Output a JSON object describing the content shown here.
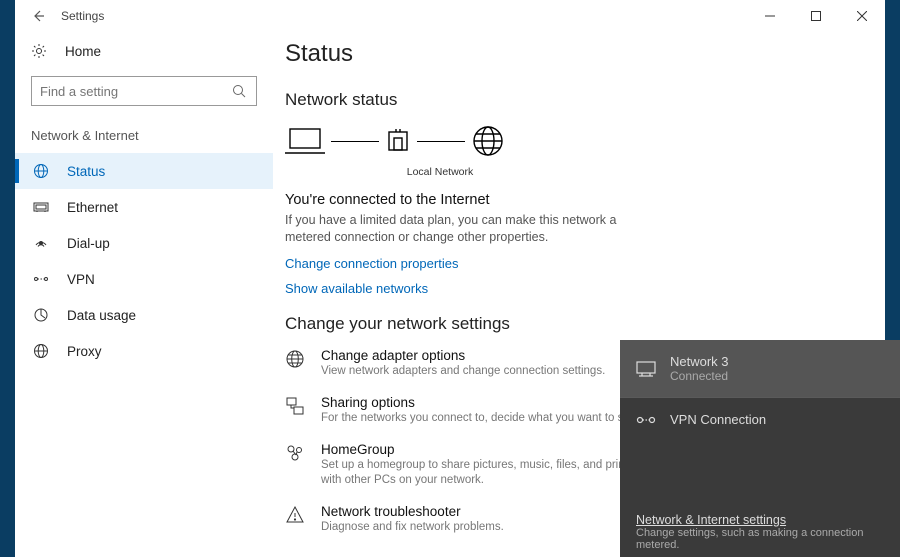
{
  "titlebar": {
    "title": "Settings"
  },
  "home_label": "Home",
  "search": {
    "placeholder": "Find a setting"
  },
  "section_label": "Network & Internet",
  "nav": {
    "status": "Status",
    "ethernet": "Ethernet",
    "dialup": "Dial-up",
    "vpn": "VPN",
    "datausage": "Data usage",
    "proxy": "Proxy"
  },
  "main": {
    "page_title": "Status",
    "status_heading": "Network status",
    "diagram_label": "Local Network",
    "connected_heading": "You're connected to the Internet",
    "connected_desc": "If you have a limited data plan, you can make this network a metered connection or change other properties.",
    "link_properties": "Change connection properties",
    "link_available": "Show available networks",
    "change_heading": "Change your network settings",
    "opt_adapter_title": "Change adapter options",
    "opt_adapter_desc": "View network adapters and change connection settings.",
    "opt_sharing_title": "Sharing options",
    "opt_sharing_desc": "For the networks you connect to, decide what you want to share.",
    "opt_homegroup_title": "HomeGroup",
    "opt_homegroup_desc": "Set up a homegroup to share pictures, music, files, and printers with other PCs on your network.",
    "opt_trouble_title": "Network troubleshooter",
    "opt_trouble_desc": "Diagnose and fix network problems."
  },
  "flyout": {
    "net_name": "Network  3",
    "net_status": "Connected",
    "vpn_name": "VPN Connection",
    "footer_title": "Network & Internet settings",
    "footer_desc": "Change settings, such as making a connection metered."
  }
}
